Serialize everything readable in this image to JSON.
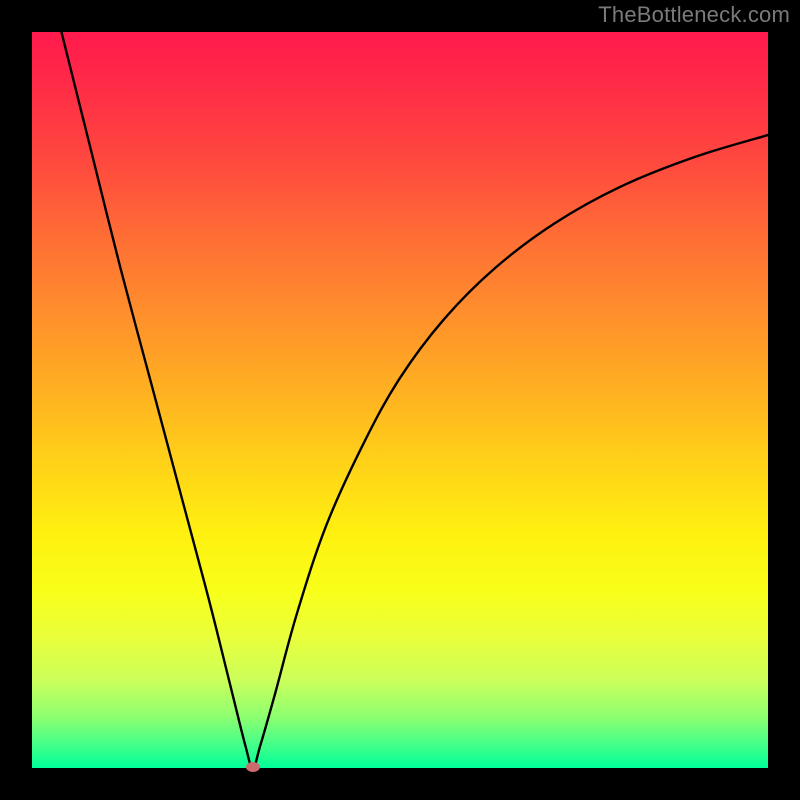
{
  "watermark": "TheBottleneck.com",
  "chart_data": {
    "type": "line",
    "title": "",
    "xlabel": "",
    "ylabel": "",
    "xlim": [
      0,
      100
    ],
    "ylim": [
      0,
      100
    ],
    "grid": false,
    "legend": false,
    "optimum_x": 30,
    "optimum_y": 0,
    "series": [
      {
        "name": "bottleneck-curve",
        "x": [
          4,
          8,
          12,
          16,
          20,
          24,
          27,
          29,
          30,
          31,
          33,
          36,
          40,
          45,
          50,
          56,
          63,
          71,
          80,
          90,
          100
        ],
        "values": [
          100,
          84,
          68,
          53,
          38,
          23,
          11,
          3,
          0,
          3,
          10,
          21,
          33,
          44,
          53,
          61,
          68,
          74,
          79,
          83,
          86
        ]
      }
    ],
    "marker": {
      "x": 30,
      "y": 0,
      "color": "#cc6b6e"
    },
    "gradient_stops": [
      {
        "pos": 0,
        "color": "#ff1a4d"
      },
      {
        "pos": 18,
        "color": "#ff4a3e"
      },
      {
        "pos": 38,
        "color": "#ff8e2c"
      },
      {
        "pos": 58,
        "color": "#ffd019"
      },
      {
        "pos": 76,
        "color": "#f8ff1a"
      },
      {
        "pos": 93,
        "color": "#8eff70"
      },
      {
        "pos": 100,
        "color": "#00ff99"
      }
    ]
  }
}
